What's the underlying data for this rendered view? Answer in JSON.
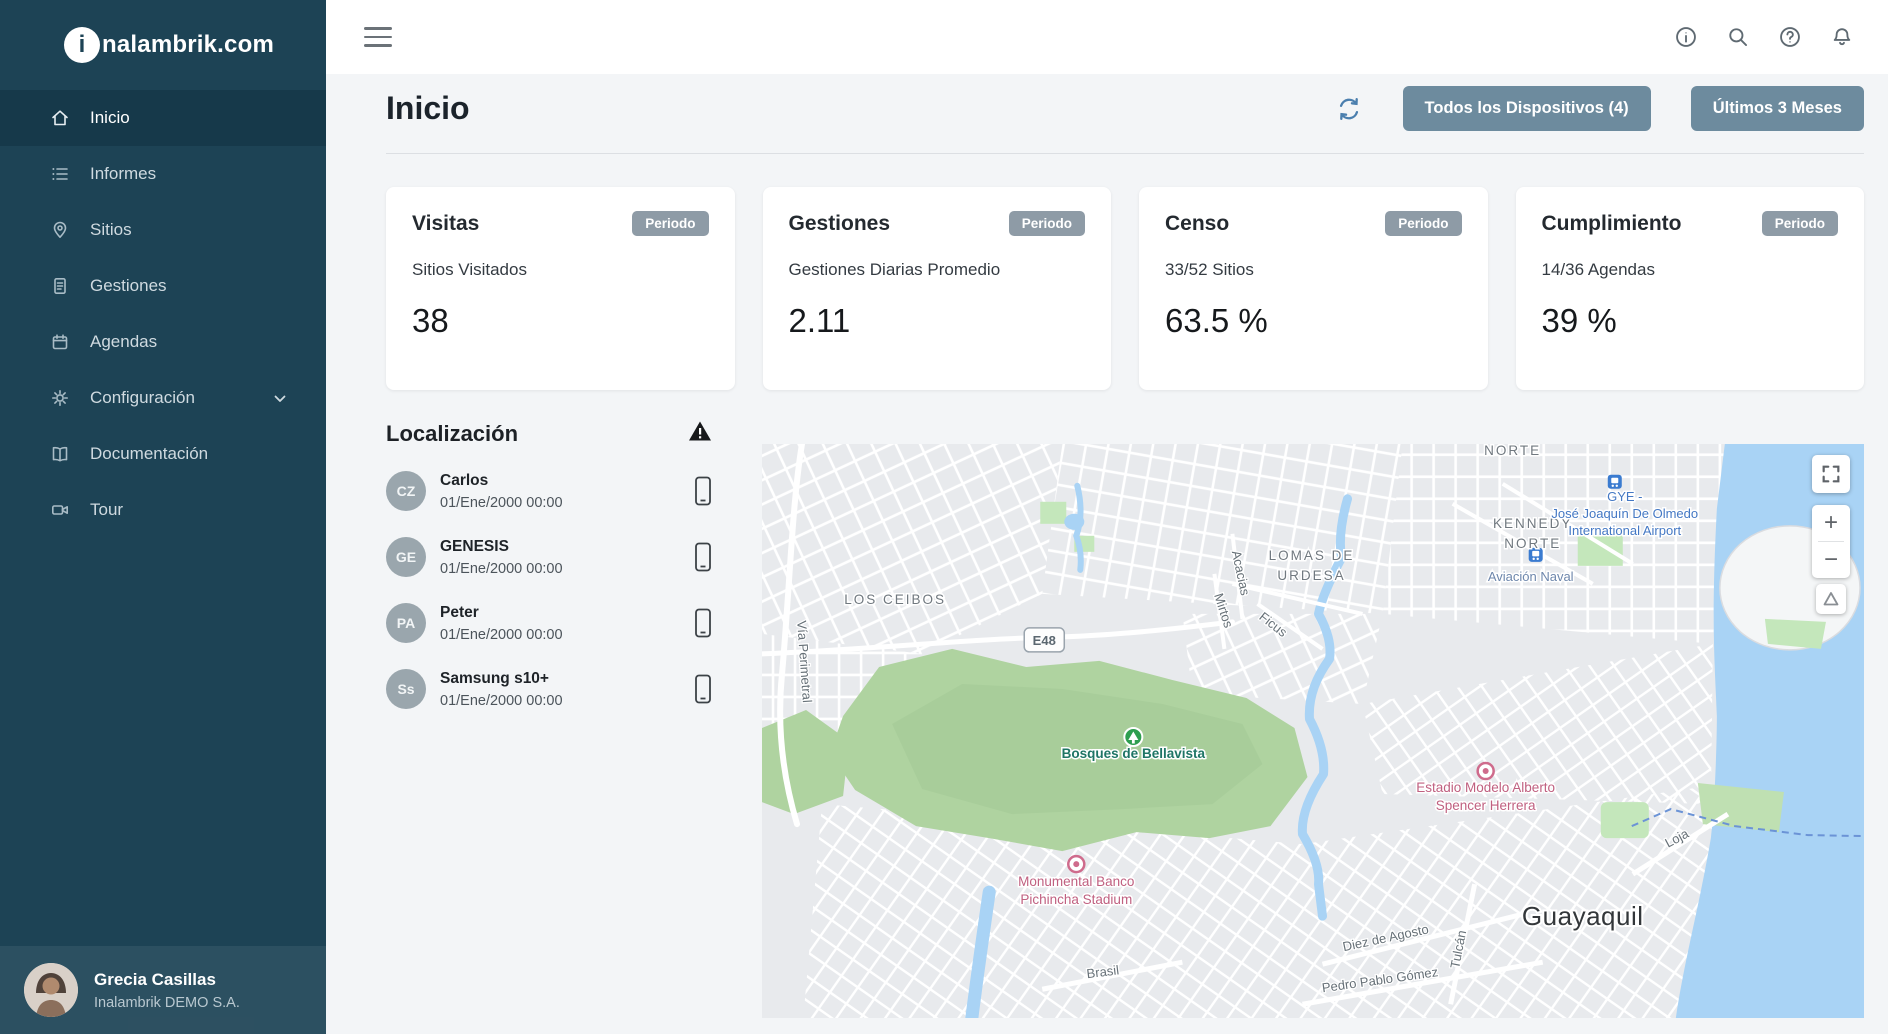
{
  "app": {
    "logo": {
      "mark_letter": "i",
      "rest": "nalambrik.com"
    },
    "title": "Inicio"
  },
  "colors": {
    "sidebar_bg": "#1d4355",
    "sidebar_active_bg": "#16394a",
    "button_bg": "#6d8b9e",
    "badge_bg": "#8e9ba6",
    "page_bg": "#f3f5f7",
    "map_water": "#a9d3f5",
    "map_park": "#c4e7bb",
    "map_hills": "#afd3a0"
  },
  "sidebar": {
    "items": [
      {
        "label": "Inicio"
      },
      {
        "label": "Informes"
      },
      {
        "label": "Sitios"
      },
      {
        "label": "Gestiones"
      },
      {
        "label": "Agendas"
      },
      {
        "label": "Configuración"
      },
      {
        "label": "Documentación"
      },
      {
        "label": "Tour"
      }
    ],
    "user": {
      "name": "Grecia Casillas",
      "org": "Inalambrik DEMO S.A."
    }
  },
  "header": {
    "buttons": [
      {
        "label": "Todos los Dispositivos (4)"
      },
      {
        "label": "Últimos 3 Meses"
      }
    ]
  },
  "cards": [
    {
      "title": "Visitas",
      "badge": "Periodo",
      "subtitle": "Sitios Visitados",
      "value": "38"
    },
    {
      "title": "Gestiones",
      "badge": "Periodo",
      "subtitle": "Gestiones Diarias Promedio",
      "value": "2.11"
    },
    {
      "title": "Censo",
      "badge": "Periodo",
      "subtitle": "33/52 Sitios",
      "value": "63.5 %"
    },
    {
      "title": "Cumplimiento",
      "badge": "Periodo",
      "subtitle": "14/36 Agendas",
      "value": "39 %"
    }
  ],
  "localization": {
    "title": "Localización",
    "devices": [
      {
        "initials": "CZ",
        "name": "Carlos",
        "timestamp": "01/Ene/2000 00:00"
      },
      {
        "initials": "GE",
        "name": "GENESIS",
        "timestamp": "01/Ene/2000 00:00"
      },
      {
        "initials": "PA",
        "name": "Peter",
        "timestamp": "01/Ene/2000 00:00"
      },
      {
        "initials": "Ss",
        "name": "Samsung s10+",
        "timestamp": "01/Ene/2000 00:00"
      }
    ]
  },
  "map": {
    "labels": {
      "norte": "NORTE",
      "kennedy_1": "KENNEDY",
      "kennedy_2": "NORTE",
      "lomas_1": "LOMAS DE",
      "lomas_2": "URDESA",
      "los_ceibos": "LOS CEIBOS",
      "aviacion_naval": "Aviación Naval",
      "gye": "GYE -",
      "airport_1": "José Joaquín De Olmedo",
      "airport_2": "International Airport",
      "bosques": "Bosques de Bellavista",
      "estadio_1": "Estadio Modelo Alberto",
      "estadio_2": "Spencer Herrera",
      "monumental_1": "Monumental Banco",
      "monumental_2": "Pichincha Stadium",
      "guayaquil": "Guayaquil",
      "via_perimetral": "Vía Perimetral",
      "acacias": "Acacias",
      "mirtos": "Mirtos",
      "ficus": "Ficus",
      "diez_de_agosto": "Diez de Agosto",
      "pedro_pablo_gomez": "Pedro Pablo Gómez",
      "brasil": "Brasil",
      "tulcan": "Tulcán",
      "loja": "Loja",
      "e48": "E48"
    },
    "controls": {
      "zoom_in": "+",
      "zoom_out": "−"
    }
  }
}
